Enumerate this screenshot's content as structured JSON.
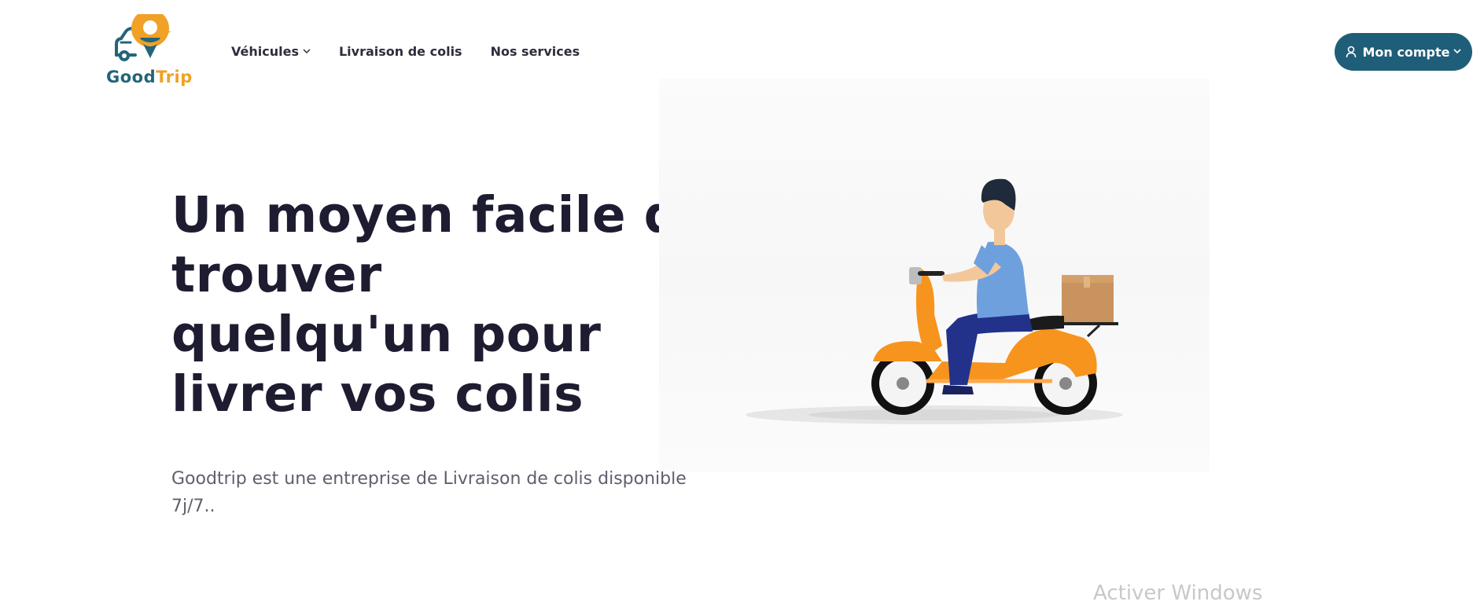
{
  "brand": {
    "name_part1": "Good",
    "name_part2": "Trip"
  },
  "nav": {
    "items": [
      {
        "label": "Véhicules",
        "has_dropdown": true
      },
      {
        "label": "Livraison de colis",
        "has_dropdown": false
      },
      {
        "label": "Nos services",
        "has_dropdown": false
      }
    ]
  },
  "account": {
    "label": "Mon compte",
    "chevron": "⌄"
  },
  "hero": {
    "title_lines": [
      "Un moyen facile de",
      "trouver",
      "quelqu'un pour",
      "livrer vos colis"
    ],
    "subtitle": "Goodtrip est une entreprise de Livraison de colis disponible 7j/7.."
  },
  "overlay": {
    "watermark": "Activer Windows"
  },
  "colors": {
    "brand_teal": "#1f5e78",
    "brand_orange": "#f0a126",
    "heading": "#1e1c30",
    "scooter": "#f7941d"
  },
  "icons": [
    "car-pin-logo-icon",
    "chevron-down-icon",
    "user-icon",
    "scooter-courier-illustration"
  ]
}
